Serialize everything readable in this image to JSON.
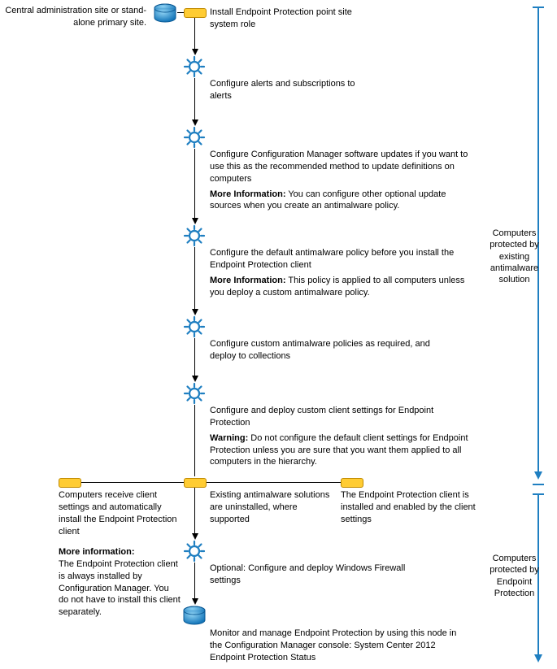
{
  "top_label": "Central administration site or stand-alone primary site.",
  "steps": {
    "s1": "Install Endpoint Protection point site system role",
    "s2": "Configure alerts and subscriptions to alerts",
    "s3_main": "Configure Configuration Manager software updates if you want to use this as the recommended method to update definitions on computers",
    "s3_info_label": "More Information:",
    "s3_info": " You can configure other optional update sources when you create an antimalware policy.",
    "s4_main": "Configure the default antimalware policy before you install the Endpoint Protection client",
    "s4_info_label": "More Information:",
    "s4_info": " This policy is applied to all computers unless you deploy a custom antimalware policy.",
    "s5": "Configure custom antimalware policies as required, and deploy to collections",
    "s6_main": "Configure and deploy custom client settings for Endpoint Protection",
    "s6_warn_label": "Warning:",
    "s6_warn": " Do not configure the default client settings for Endpoint Protection unless you are sure that you want them applied to all computers in the hierarchy.",
    "branch_left": "Computers receive client settings and automatically install the Endpoint Protection client",
    "branch_mid": "Existing antimalware solutions are uninstalled, where supported",
    "branch_right": "The Endpoint Protection client is installed and enabled by the client settings",
    "more_info_label": "More information:",
    "more_info_body": "The Endpoint Protection client is always installed by Configuration Manager. You do not have to install this client separately.",
    "s7": "Optional: Configure and deploy Windows Firewall settings",
    "s8": "Monitor and manage Endpoint Protection by using this node in the Configuration Manager console: System Center 2012 Endpoint Protection Status"
  },
  "side": {
    "upper": "Computers protected by existing antimalware solution",
    "lower": "Computers protected by Endpoint Protection"
  }
}
